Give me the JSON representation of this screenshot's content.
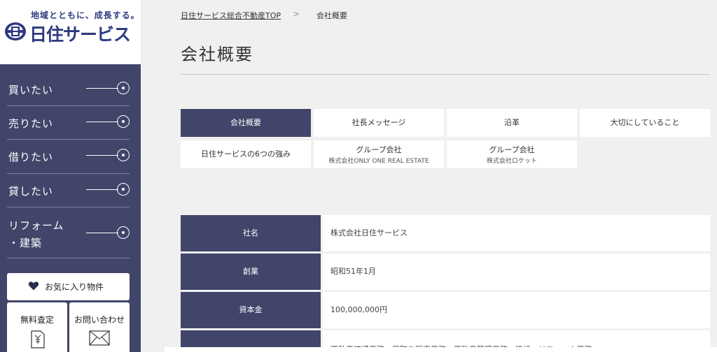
{
  "logo": {
    "tagline": "地域とともに、成長する。",
    "name": "日住サービス"
  },
  "nav": [
    {
      "label": "買いたい"
    },
    {
      "label": "売りたい"
    },
    {
      "label": "借りたい"
    },
    {
      "label": "貸したい"
    },
    {
      "label_line1": "リフォーム",
      "label_line2": "・建築"
    }
  ],
  "buttons": {
    "favorites": "お気に入り物件",
    "assessment": "無料査定",
    "contact": "お問い合わせ"
  },
  "breadcrumb": {
    "top": "日住サービス総合不動産TOP",
    "separator": ">",
    "current": "会社概要"
  },
  "page_title": "会社概要",
  "tabs": [
    {
      "label": "会社概要",
      "active": true
    },
    {
      "label": "社長メッセージ"
    },
    {
      "label": "沿革"
    },
    {
      "label": "大切にしていること"
    },
    {
      "label": "日住サービスの6つの強み"
    },
    {
      "label": "グループ会社",
      "sub": "株式会社ONLY ONE REAL ESTATE"
    },
    {
      "label": "グループ会社",
      "sub": "株式会社ロケット"
    }
  ],
  "company_info": [
    {
      "head": "社名",
      "value": "株式会社日住サービス"
    },
    {
      "head": "創業",
      "value": "昭和51年1月"
    },
    {
      "head": "資本金",
      "value": "100,000,000円"
    },
    {
      "head": "",
      "value": "不動産流通業務、買取り販売業務、不動産管理業務、建設・リフォーム業務"
    }
  ],
  "colors": {
    "navy": "#404569",
    "logo_blue": "#2e3a80",
    "page_bg": "#f0f0f0"
  }
}
